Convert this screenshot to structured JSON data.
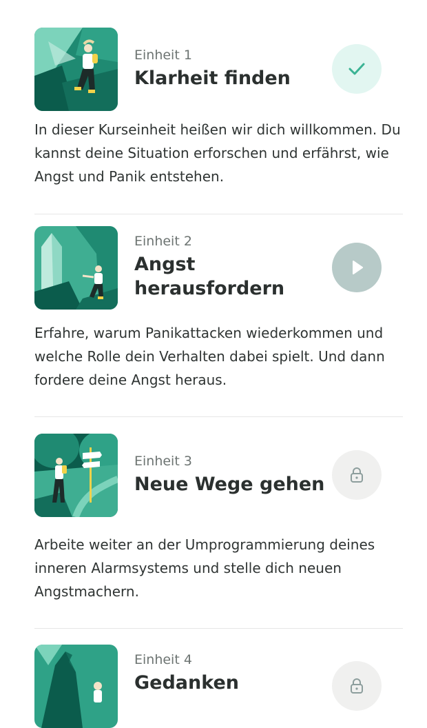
{
  "units": [
    {
      "label": "Einheit 1",
      "title": "Klarheit finden",
      "description": "In dieser Kurseinheit heißen wir dich willkommen. Du kannst deine Situation erforschen und erfährst, wie Angst und Panik entstehen.",
      "status": "completed",
      "status_icon": "check-icon"
    },
    {
      "label": "Einheit 2",
      "title": "Angst herausfordern",
      "description": "Erfahre, warum Panikattacken wiederkommen und welche Rolle dein Verhalten dabei spielt. Und dann fordere deine Angst heraus.",
      "status": "available",
      "status_icon": "play-icon"
    },
    {
      "label": "Einheit 3",
      "title": "Neue Wege gehen",
      "description": "Arbeite weiter an der Umprogrammierung deines inneren Alarmsystems und stelle dich neuen Angstmachern.",
      "status": "locked",
      "status_icon": "lock-icon"
    },
    {
      "label": "Einheit 4",
      "title": "Gedanken",
      "status": "locked",
      "status_icon": "lock-icon"
    }
  ],
  "colors": {
    "accent": "#3bb394",
    "illustration_dark": "#0b5c4c",
    "illustration_mid": "#1f8a72",
    "illustration_light": "#7cd3bb"
  }
}
